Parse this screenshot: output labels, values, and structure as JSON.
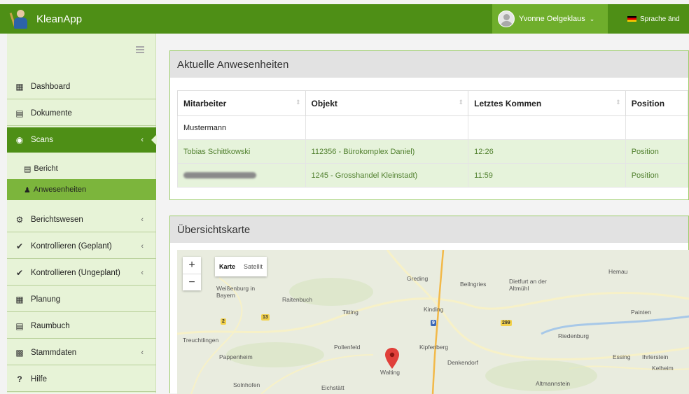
{
  "app": {
    "title": "KleanApp"
  },
  "header": {
    "user_name": "Yvonne Oelgeklaus",
    "language_label": "Sprache änd"
  },
  "sidebar": {
    "items": [
      {
        "label": "Dashboard",
        "icon": "bar-chart-icon"
      },
      {
        "label": "Dokumente",
        "icon": "document-icon"
      },
      {
        "label": "Scans",
        "icon": "scan-icon",
        "active": true
      },
      {
        "label": "Berichtswesen",
        "icon": "cogs-icon"
      },
      {
        "label": "Kontrollieren (Geplant)",
        "icon": "check-icon"
      },
      {
        "label": "Kontrollieren (Ungeplant)",
        "icon": "check-icon"
      },
      {
        "label": "Planung",
        "icon": "calendar-icon"
      },
      {
        "label": "Raumbuch",
        "icon": "book-icon"
      },
      {
        "label": "Stammdaten",
        "icon": "clipboard-icon"
      },
      {
        "label": "Hilfe",
        "icon": "question-icon"
      }
    ],
    "subitems": [
      {
        "label": "Bericht",
        "icon": "table-icon"
      },
      {
        "label": "Anwesenheiten",
        "icon": "users-icon",
        "active": true
      }
    ]
  },
  "presence_panel": {
    "title": "Aktuelle Anwesenheiten",
    "columns": [
      "Mitarbeiter",
      "Objekt",
      "Letztes Kommen",
      "Position"
    ],
    "rows": [
      {
        "mitarbeiter": "Mustermann",
        "objekt": "",
        "kommen": "",
        "position": ""
      },
      {
        "mitarbeiter": "Tobias Schittkowski",
        "objekt": "112356 - Bürokomplex Daniel)",
        "kommen": "12:26",
        "position": "Position"
      },
      {
        "mitarbeiter": "",
        "objekt": "1245 - Grosshandel Kleinstadt)",
        "kommen": "11:59",
        "position": "Position"
      }
    ]
  },
  "map_panel": {
    "title": "Übersichtskarte",
    "zoom_in": "+",
    "zoom_out": "−",
    "map_type": {
      "map": "Karte",
      "satellite": "Satellit"
    },
    "places": [
      "Weißenburg in Bayern",
      "Raitenbuch",
      "Titting",
      "Greding",
      "Beilngries",
      "Dietfurt an der Altmühl",
      "Kinding",
      "Hemau",
      "Treuchtlingen",
      "Pollenfeld",
      "Kipfenberg",
      "Riedenburg",
      "Painten",
      "Pappenheim",
      "Denkendorf",
      "Essing",
      "Ihrlerstein",
      "Kelheim",
      "Walting",
      "Solnhofen",
      "Eichstätt",
      "Altmannstein"
    ],
    "road_numbers": [
      "2",
      "13",
      "299",
      "9"
    ]
  },
  "colors": {
    "brand": "#4e8f16",
    "accent": "#7cb53c",
    "sidebar_bg": "#e7f3d7"
  }
}
